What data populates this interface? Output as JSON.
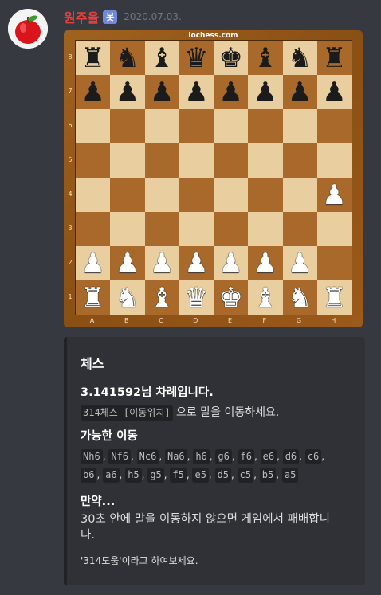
{
  "message": {
    "username": "원주율",
    "bot_tag": "봇",
    "timestamp": "2020.07.03."
  },
  "board": {
    "site": "iochess.com",
    "files": [
      "A",
      "B",
      "C",
      "D",
      "E",
      "F",
      "G",
      "H"
    ],
    "ranks": [
      "8",
      "7",
      "6",
      "5",
      "4",
      "3",
      "2",
      "1"
    ],
    "rows": [
      [
        "r",
        "n",
        "b",
        "q",
        "k",
        "b",
        "n",
        "r"
      ],
      [
        "p",
        "p",
        "p",
        "p",
        "p",
        "p",
        "p",
        "p"
      ],
      [
        "",
        "",
        "",
        "",
        "",
        "",
        "",
        ""
      ],
      [
        "",
        "",
        "",
        "",
        "",
        "",
        "",
        ""
      ],
      [
        "",
        "",
        "",
        "",
        "",
        "",
        "",
        "P"
      ],
      [
        "",
        "",
        "",
        "",
        "",
        "",
        "",
        ""
      ],
      [
        "P",
        "P",
        "P",
        "P",
        "P",
        "P",
        "P",
        ""
      ],
      [
        "R",
        "N",
        "B",
        "Q",
        "K",
        "B",
        "N",
        "R"
      ]
    ],
    "colors": {
      "light": "#e9cf9f",
      "dark": "#a8692a"
    }
  },
  "embed": {
    "title": "체스",
    "turn_heading": "3.141592님 차례입니다.",
    "command": "314체스 [이동위치]",
    "instruction": "으로 말을 이동하세요.",
    "moves_heading": "가능한 이동",
    "moves": [
      "Nh6",
      "Nf6",
      "Nc6",
      "Na6",
      "h6",
      "g6",
      "f6",
      "e6",
      "d6",
      "c6",
      "b6",
      "a6",
      "h5",
      "g5",
      "f5",
      "e5",
      "d5",
      "c5",
      "b5",
      "a5"
    ],
    "warning_heading": "만약...",
    "warning_text": "30초 안에 말을 이동하지 않으면 게임에서 패배합니다.",
    "footer": "'314도움'이라고 하여보세요."
  },
  "colors": {
    "username": "#e8403c",
    "bot_tag": "#7289da",
    "background": "#36393f",
    "embed": "#2f3136"
  }
}
